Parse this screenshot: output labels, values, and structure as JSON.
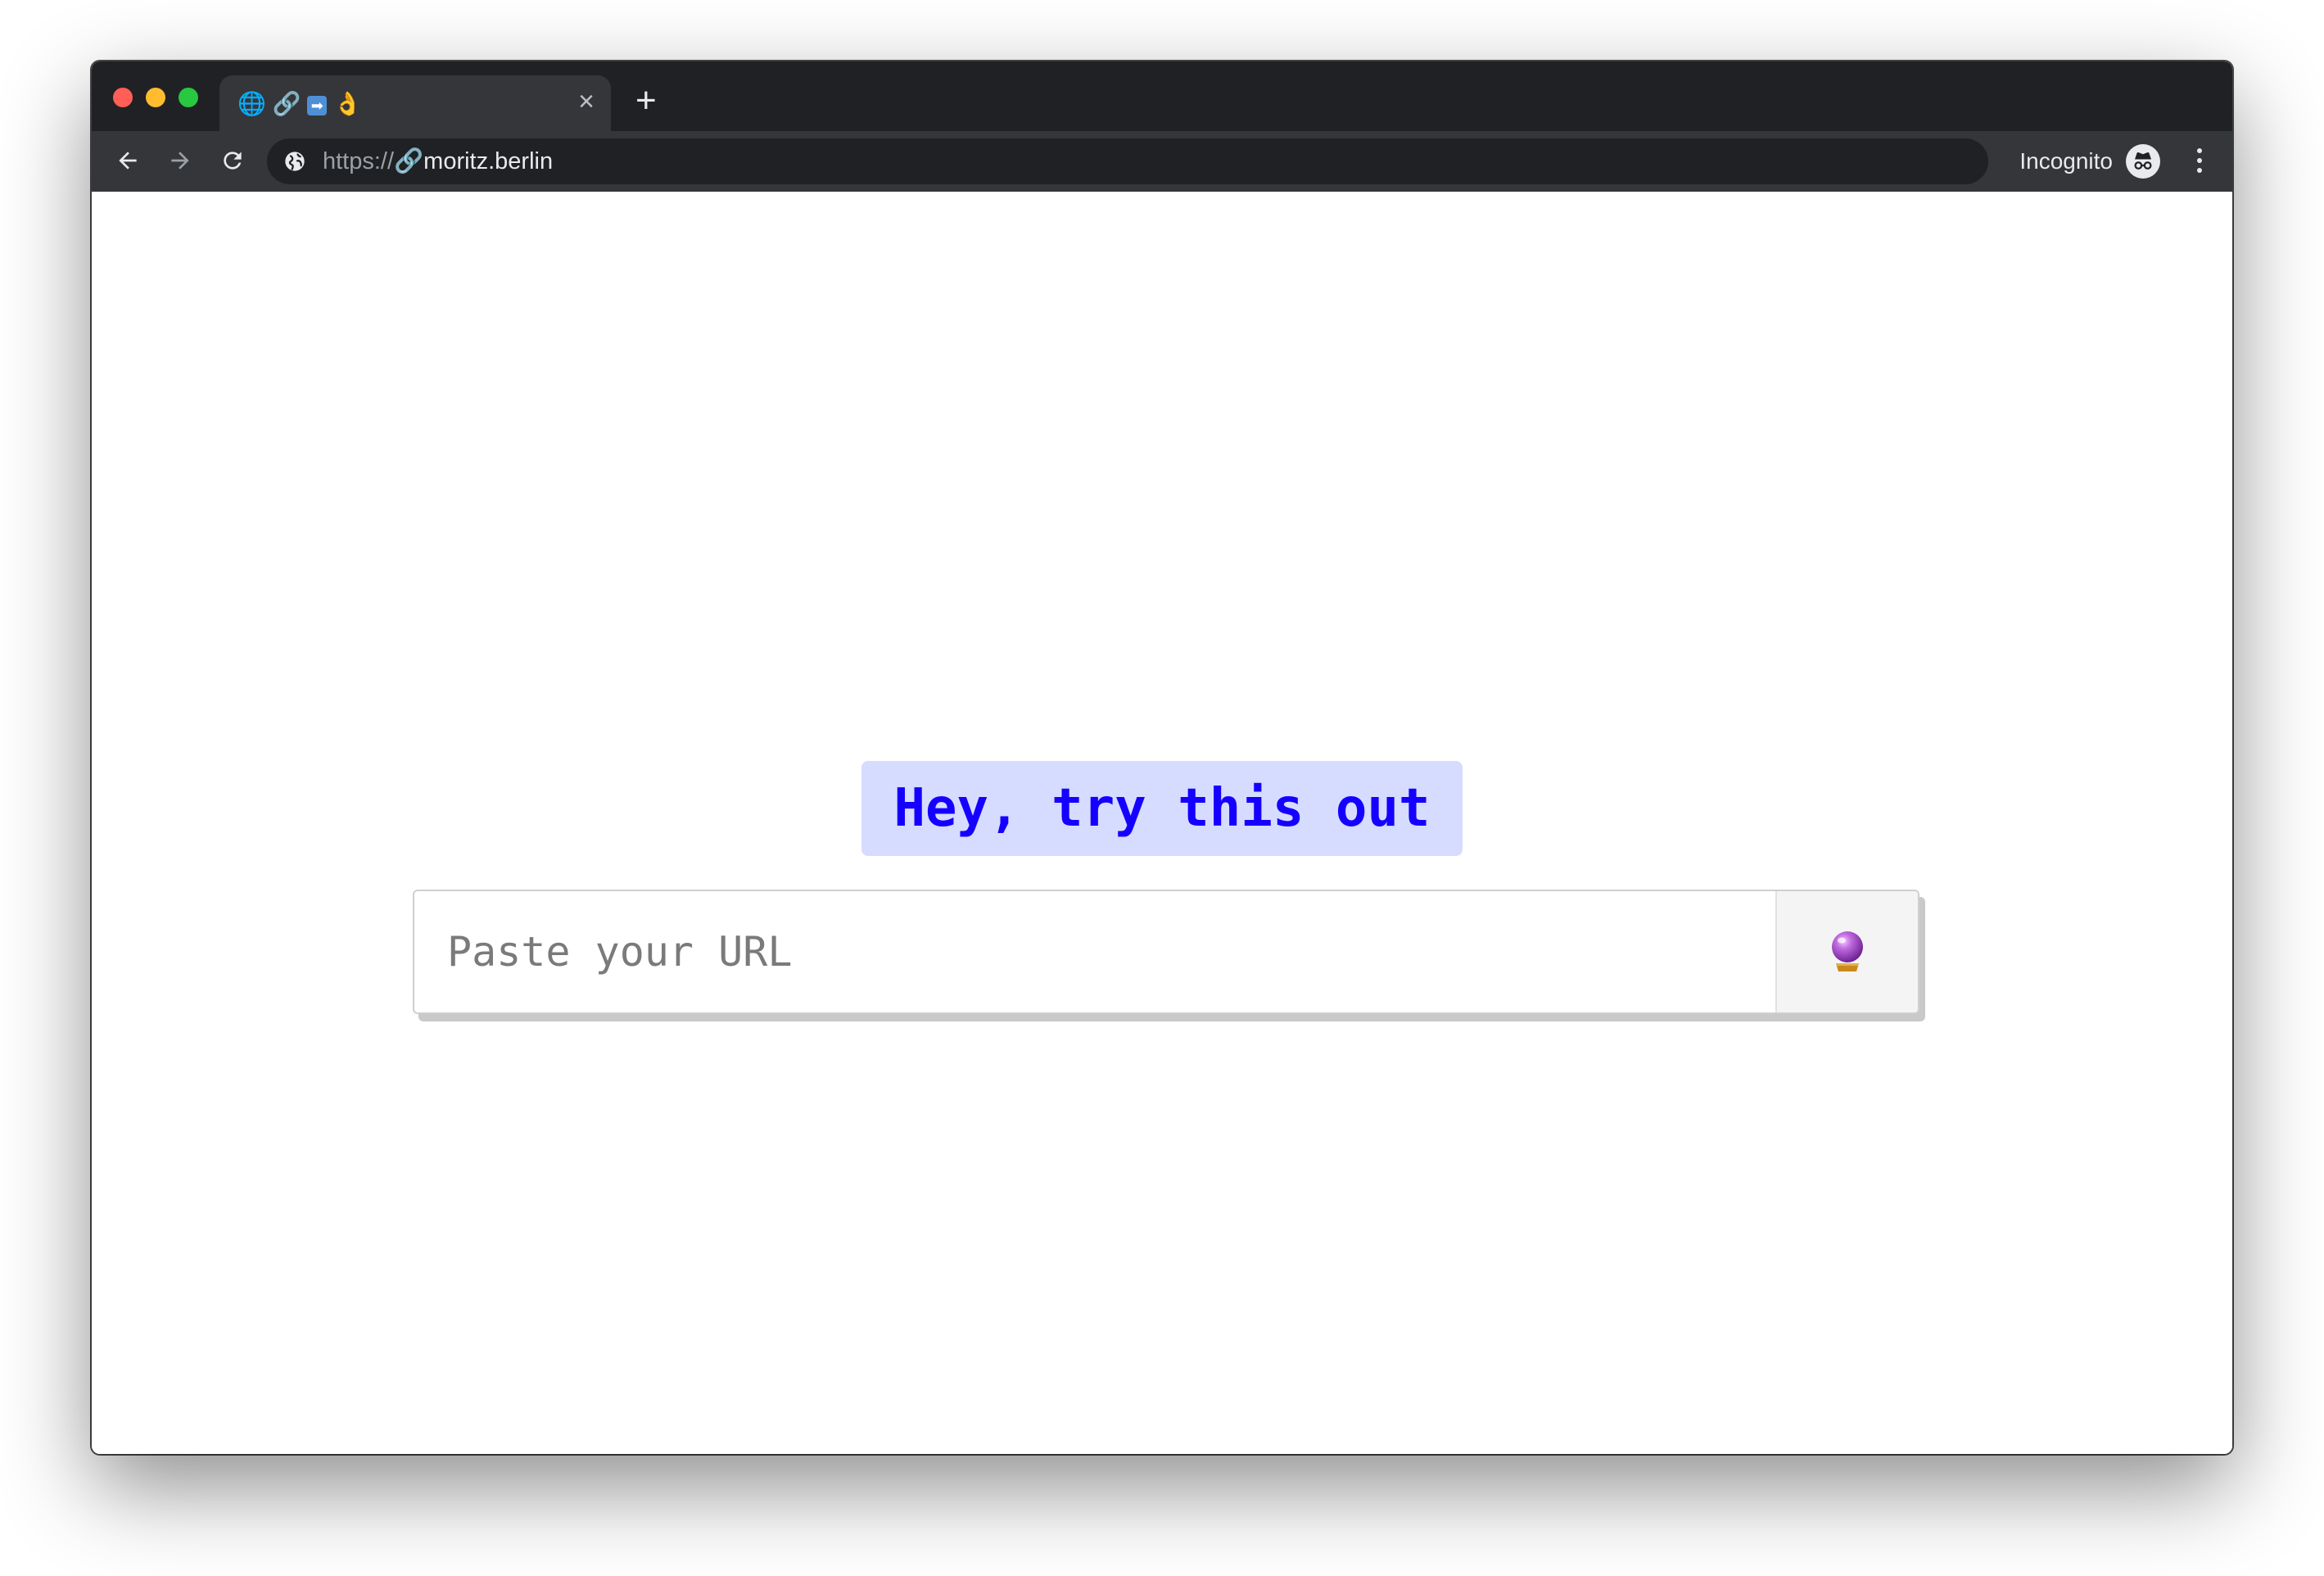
{
  "browser": {
    "tab": {
      "title_parts": [
        "🌐",
        "🔗",
        "➡",
        "👌"
      ],
      "close_glyph": "×"
    },
    "new_tab_glyph": "+",
    "address": {
      "scheme": "https://🔗",
      "host": "moritz.berlin"
    },
    "profile_label": "Incognito",
    "icons": [
      "back-arrow-icon",
      "forward-arrow-icon",
      "reload-icon",
      "globe-icon",
      "incognito-icon",
      "more-vert-icon",
      "crystal-ball-icon"
    ]
  },
  "page": {
    "headline": "Hey, try this out",
    "input_placeholder": "Paste your URL",
    "input_value": "",
    "colors": {
      "headline_bg": "#d6dcff",
      "headline_text": "#1500ff"
    }
  }
}
